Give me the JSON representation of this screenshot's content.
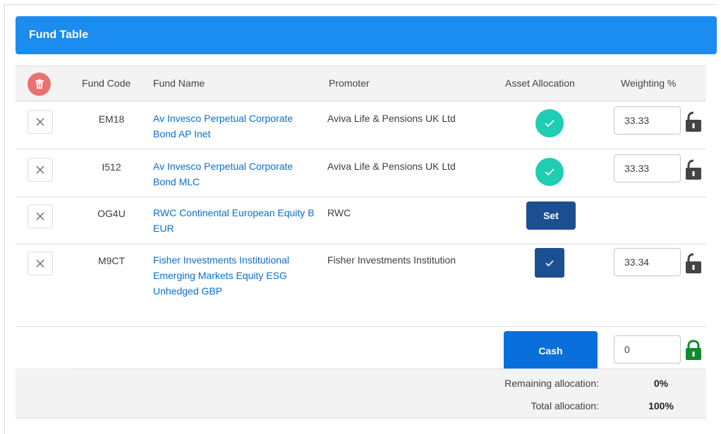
{
  "header": {
    "title": "Fund Table"
  },
  "columns": {
    "fund_code": "Fund Code",
    "fund_name": "Fund Name",
    "promoter": "Promoter",
    "asset_allocation": "Asset Allocation",
    "weighting": "Weighting %"
  },
  "funds": [
    {
      "code": "EM18",
      "name": "Av Invesco Perpetual Corporate Bond AP Inet",
      "promoter": "Aviva Life & Pensions UK Ltd",
      "allocation": "complete",
      "weighting": "33.33"
    },
    {
      "code": "I512",
      "name": "Av Invesco Perpetual Corporate Bond MLC",
      "promoter": "Aviva Life & Pensions UK Ltd",
      "allocation": "complete",
      "weighting": "33.33"
    },
    {
      "code": "OG4U",
      "name": "RWC Continental European Equity B EUR",
      "promoter": "RWC",
      "allocation": "unset",
      "set_label": "Set"
    },
    {
      "code": "M9CT",
      "name": "Fisher Investments Institutional Emerging Markets Equity ESG Unhedged GBP",
      "promoter": "Fisher Investments Institution",
      "allocation": "selected",
      "weighting": "33.34"
    }
  ],
  "cash": {
    "label": "Cash",
    "weighting": "0"
  },
  "summary": {
    "remaining_label": "Remaining allocation:",
    "remaining_value": "0%",
    "total_label": "Total allocation:",
    "total_value": "100%"
  },
  "colors": {
    "header": "#1b8cf0",
    "link": "#0a6fce",
    "teal_check": "#1fcdb2",
    "navy": "#1b4f92",
    "delete_all": "#e9716f",
    "lock_locked": "#118b2c",
    "lock_unlocked": "#444444"
  },
  "icons": {
    "delete_all": "trash-icon",
    "remove_row": "close-icon",
    "allocation_done": "check-icon",
    "weight_unlocked": "unlock-icon",
    "cash_locked": "lock-icon"
  }
}
